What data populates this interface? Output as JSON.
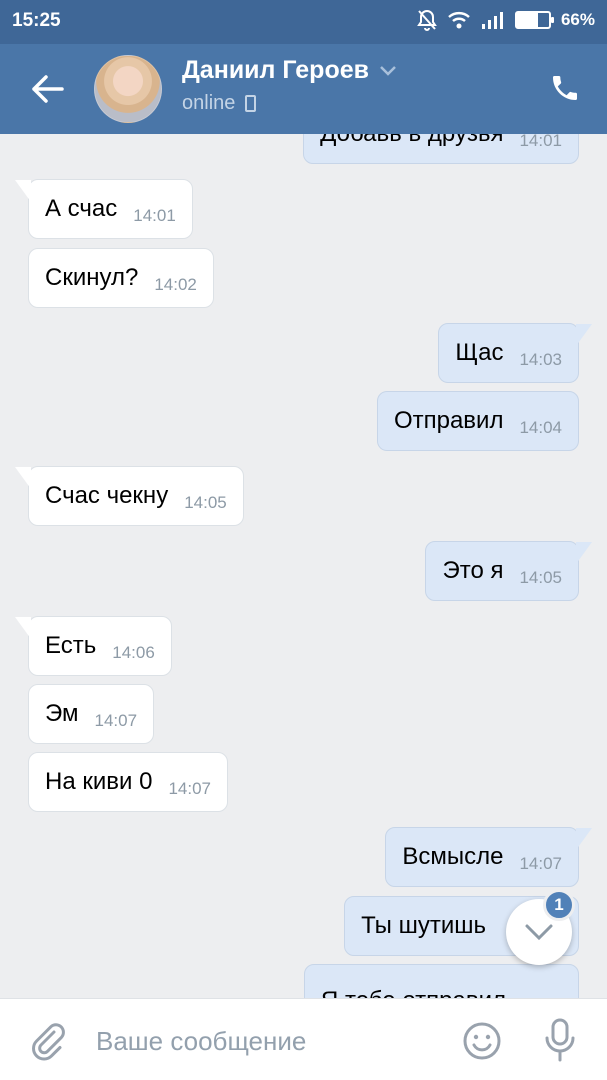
{
  "status_bar": {
    "time": "15:25",
    "battery": "66%",
    "battery_level": 0.66
  },
  "header": {
    "name": "Даниил Героев",
    "status": "online"
  },
  "messages": [
    {
      "dir": "out",
      "text": "Добавь в друзья",
      "time": "14:01"
    },
    {
      "dir": "in",
      "text": "А счас",
      "time": "14:01"
    },
    {
      "dir": "in",
      "text": "Скинул?",
      "time": "14:02"
    },
    {
      "dir": "out",
      "text": "Щас",
      "time": "14:03"
    },
    {
      "dir": "out",
      "text": "Отправил",
      "time": "14:04"
    },
    {
      "dir": "in",
      "text": "Счас чекну",
      "time": "14:05"
    },
    {
      "dir": "out",
      "text": "Это я",
      "time": "14:05"
    },
    {
      "dir": "in",
      "text": "Есть",
      "time": "14:06"
    },
    {
      "dir": "in",
      "text": "Эм",
      "time": "14:07"
    },
    {
      "dir": "in",
      "text": "На киви 0",
      "time": "14:07"
    },
    {
      "dir": "out",
      "text": "Всмысле",
      "time": "14:07"
    },
    {
      "dir": "out",
      "text": "Ты шутишь",
      "time": ""
    },
    {
      "dir": "out",
      "text": "Я тебе отправил",
      "time": ""
    }
  ],
  "scroll_button": {
    "unread_count": "1"
  },
  "composer": {
    "placeholder": "Ваше сообщение"
  },
  "colors": {
    "header": "#4a76a8",
    "statusbar": "#3f6797",
    "outgoing": "#dbe7f7",
    "incoming": "#ffffff",
    "background": "#edeef0"
  }
}
